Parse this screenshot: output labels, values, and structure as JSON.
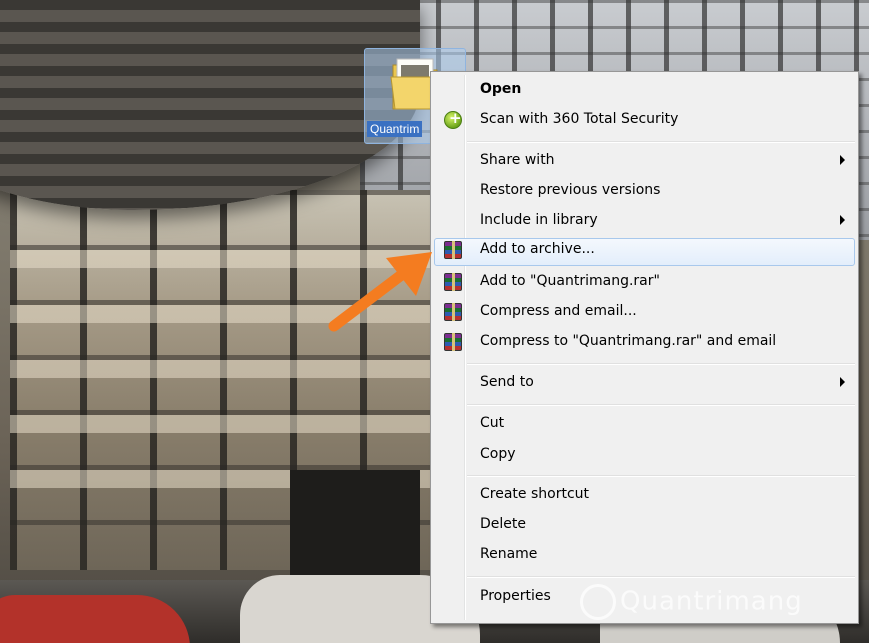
{
  "desktop_icon": {
    "label": "Quantrim",
    "icon": "folder-icon"
  },
  "context_menu": {
    "items": [
      {
        "label": "Open",
        "bold": true
      },
      {
        "label": "Scan with 360 Total Security",
        "icon": "360-security-icon"
      },
      {
        "label": "Share with",
        "submenu": true
      },
      {
        "label": "Restore previous versions"
      },
      {
        "label": "Include in library",
        "submenu": true
      },
      {
        "label": "Add to archive...",
        "icon": "winrar-icon",
        "highlighted": true
      },
      {
        "label": "Add to \"Quantrimang.rar\"",
        "icon": "winrar-icon"
      },
      {
        "label": "Compress and email...",
        "icon": "winrar-icon"
      },
      {
        "label": "Compress to \"Quantrimang.rar\" and email",
        "icon": "winrar-icon"
      },
      {
        "label": "Send to",
        "submenu": true
      },
      {
        "label": "Cut"
      },
      {
        "label": "Copy"
      },
      {
        "label": "Create shortcut"
      },
      {
        "label": "Delete"
      },
      {
        "label": "Rename"
      },
      {
        "label": "Properties"
      }
    ]
  },
  "watermark": {
    "text": "Quantrimang"
  },
  "colors": {
    "highlight_border": "#a8c8ec",
    "arrow": "#f47c20",
    "menu_bg": "#f0f0f0"
  }
}
